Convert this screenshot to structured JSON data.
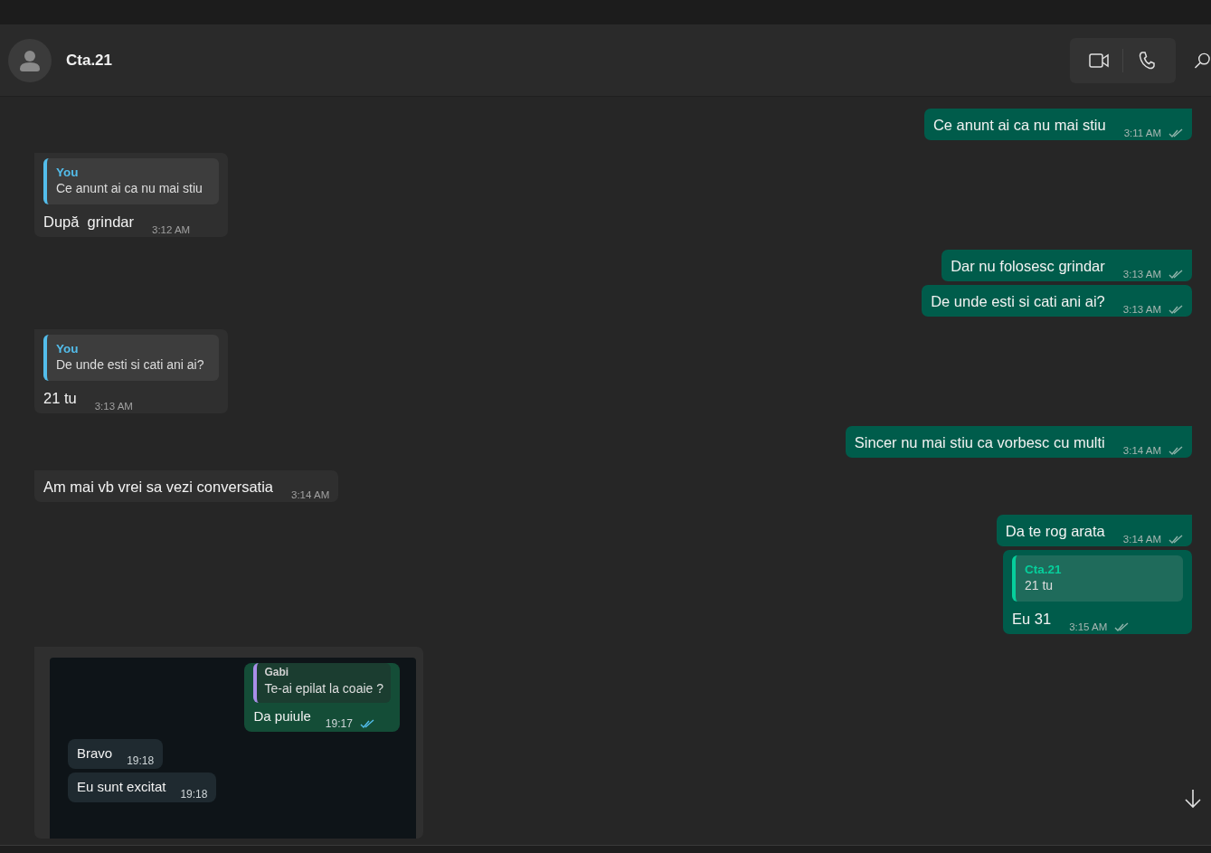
{
  "header": {
    "contact_name": "Cta.21"
  },
  "messages": [
    {
      "kind": "text",
      "outgoing": true,
      "text": "Ce anunt ai ca nu mai stiu",
      "time": "3:11 AM",
      "read": false
    },
    {
      "kind": "reply",
      "outgoing": false,
      "quote": {
        "sender": "You",
        "text": "Ce anunt ai ca nu mai stiu"
      },
      "text": "După  grindar",
      "time": "3:12 AM"
    },
    {
      "kind": "text",
      "outgoing": true,
      "text": "Dar nu folosesc grindar",
      "time": "3:13 AM",
      "read": false
    },
    {
      "kind": "text",
      "outgoing": true,
      "text": "De unde esti si cati ani ai?",
      "time": "3:13 AM",
      "read": false
    },
    {
      "kind": "reply",
      "outgoing": false,
      "quote": {
        "sender": "You",
        "text": "De unde esti si cati ani ai?"
      },
      "text": "21 tu",
      "time": "3:13 AM"
    },
    {
      "kind": "text",
      "outgoing": true,
      "text": "Sincer nu mai stiu ca vorbesc cu multi",
      "time": "3:14 AM",
      "read": false
    },
    {
      "kind": "text",
      "outgoing": false,
      "text": "Am mai vb vrei sa vezi conversatia",
      "time": "3:14 AM"
    },
    {
      "kind": "text",
      "outgoing": true,
      "text": "Da te rog arata",
      "time": "3:14 AM",
      "read": false
    },
    {
      "kind": "reply",
      "outgoing": true,
      "quote": {
        "sender": "Cta.21",
        "text": "21 tu"
      },
      "text": "Eu 31",
      "time": "3:15 AM",
      "read": false
    },
    {
      "kind": "image",
      "outgoing": false,
      "screenshot": {
        "messages": [
          {
            "outgoing": true,
            "quote": {
              "sender": "Gabi",
              "text": "Te-ai epilat la coaie ?"
            },
            "text": "Da puiule",
            "time": "19:17",
            "read": true
          },
          {
            "outgoing": false,
            "text": "Bravo",
            "time": "19:18"
          },
          {
            "outgoing": false,
            "text": "Eu sunt excitat",
            "time": "19:18"
          }
        ]
      }
    }
  ]
}
